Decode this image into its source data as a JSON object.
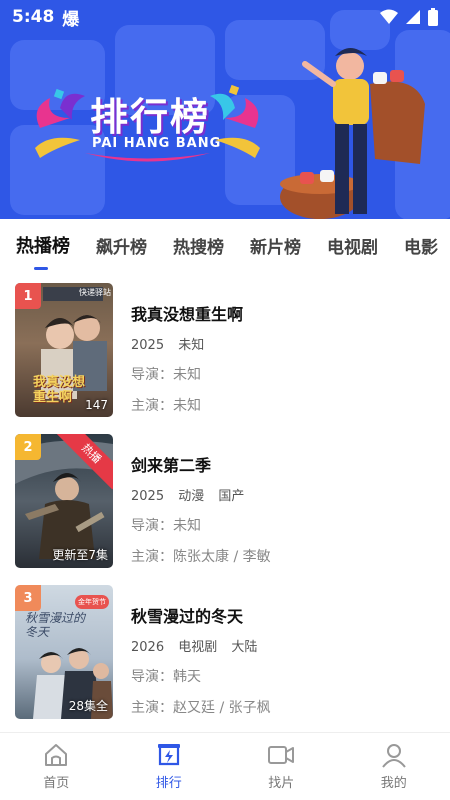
{
  "status_bar": {
    "time": "5:48",
    "burst_label": "爆"
  },
  "banner": {
    "title": "排行榜",
    "subtitle": "PAI HANG BANG"
  },
  "tabs": [
    {
      "label": "热播榜",
      "active": true
    },
    {
      "label": "飙升榜"
    },
    {
      "label": "热搜榜"
    },
    {
      "label": "新片榜"
    },
    {
      "label": "电视剧"
    },
    {
      "label": "电影"
    }
  ],
  "items": [
    {
      "rank": "1",
      "rank_color": "#e8534f",
      "title": "我真没想重生啊",
      "year": "2025",
      "tags": [
        "未知"
      ],
      "director": "导演：未知",
      "cast": "主演：未知",
      "episode_badge": "147",
      "poster_text": "我真没想重生啊",
      "poster_sign": "快递驿站"
    },
    {
      "rank": "2",
      "rank_color": "#f5b731",
      "title": "剑来第二季",
      "year": "2025",
      "tags": [
        "动漫",
        "国产"
      ],
      "director": "导演：未知",
      "cast": "主演：陈张太康 / 李敏",
      "episode_badge": "更新至7集",
      "hot_label": "热播"
    },
    {
      "rank": "3",
      "rank_color": "#f08a5a",
      "title": "秋雪漫过的冬天",
      "year": "2026",
      "tags": [
        "电视剧",
        "大陆"
      ],
      "director": "导演：韩天",
      "cast": "主演：赵又廷 / 张子枫",
      "episode_badge": "28集全",
      "poster_text": "秋雪漫过的冬天",
      "poster_badge": "金年贺节"
    }
  ],
  "bottom_nav": [
    {
      "label": "首页",
      "icon": "home-icon"
    },
    {
      "label": "排行",
      "icon": "rank-icon",
      "active": true
    },
    {
      "label": "找片",
      "icon": "video-camera-icon"
    },
    {
      "label": "我的",
      "icon": "user-icon"
    }
  ],
  "colors": {
    "accent": "#2f57e6",
    "banner_bg": "#2f57e6"
  }
}
